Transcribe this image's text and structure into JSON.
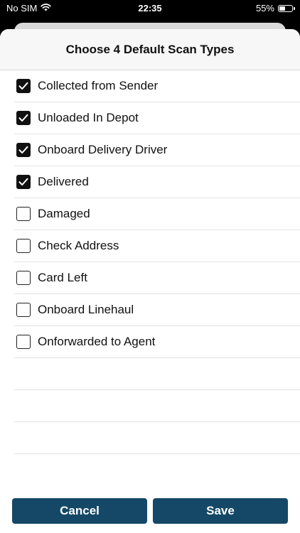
{
  "status_bar": {
    "carrier": "No SIM",
    "time": "22:35",
    "battery_percent": "55%",
    "battery_level": 0.55,
    "icons": [
      "wifi-icon",
      "battery-icon"
    ]
  },
  "sheet": {
    "title": "Choose 4 Default Scan Types",
    "items": [
      {
        "label": "Collected from Sender",
        "checked": true
      },
      {
        "label": "Unloaded In Depot",
        "checked": true
      },
      {
        "label": "Onboard Delivery Driver",
        "checked": true
      },
      {
        "label": "Delivered",
        "checked": true
      },
      {
        "label": "Damaged",
        "checked": false
      },
      {
        "label": "Check Address",
        "checked": false
      },
      {
        "label": "Card Left",
        "checked": false
      },
      {
        "label": "Onboard Linehaul",
        "checked": false
      },
      {
        "label": "Onforwarded to Agent",
        "checked": false
      }
    ]
  },
  "footer": {
    "cancel_label": "Cancel",
    "save_label": "Save"
  },
  "colors": {
    "button_bg": "#144866",
    "button_text": "#ffffff",
    "checkbox_checked": "#111111"
  }
}
